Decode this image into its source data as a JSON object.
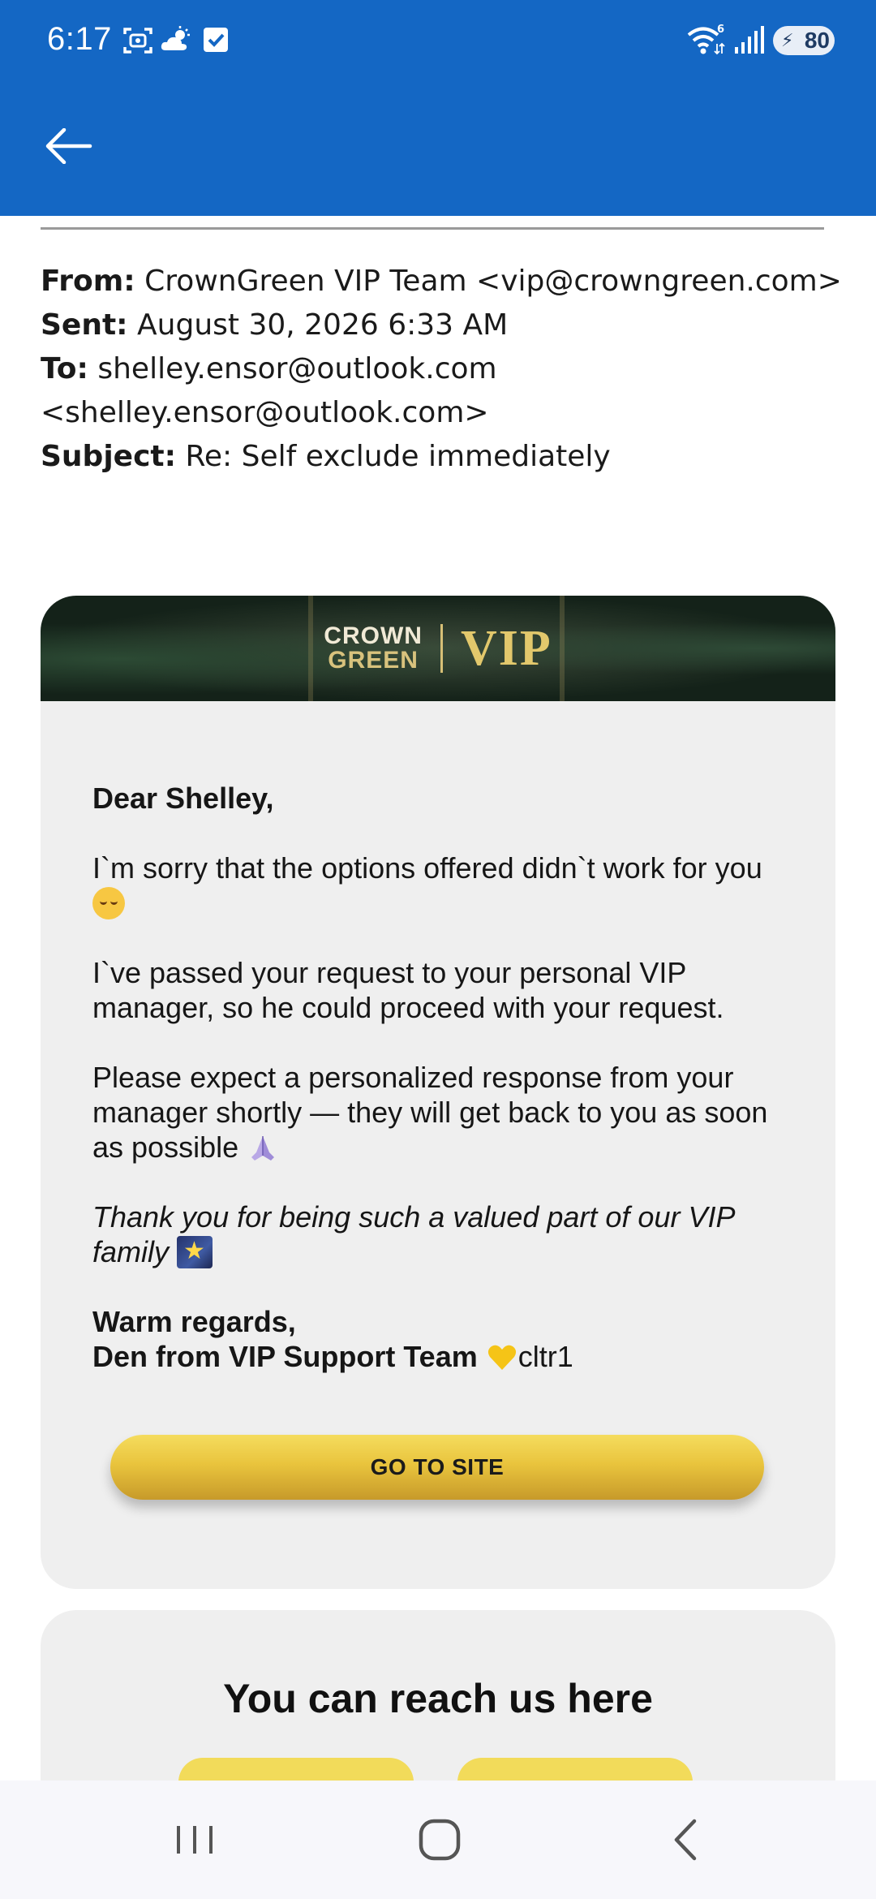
{
  "status_bar": {
    "time": "6:17",
    "battery_level": "80",
    "icons": [
      "screenshot-icon",
      "weather-cloud-icon",
      "checkbox-icon",
      "wifi-6-icon",
      "signal-icon",
      "battery-icon"
    ]
  },
  "app_bar": {
    "back_icon": "arrow-left-icon",
    "color": "#1467c4"
  },
  "email": {
    "from_label": "From:",
    "from_value": "CrownGreen VIP Team <vip@crowngreen.com>",
    "sent_label": "Sent:",
    "sent_value": "August 30, 2026 6:33 AM",
    "to_label": "To:",
    "to_value_line1": "shelley.ensor@outlook.com",
    "to_value_line2": "<shelley.ensor@outlook.com>",
    "subject_label": "Subject:",
    "subject_value": "Re: Self exclude immediately"
  },
  "banner": {
    "logo_line1": "CROWN",
    "logo_line2": "GREEN",
    "logo_vip": "VIP"
  },
  "message": {
    "greeting": "Dear Shelley,",
    "p1": "I`m sorry that the options offered didn`t work for you",
    "p2": "I`ve passed your request to your personal VIP manager, so he could proceed with your request.",
    "p3": "Please expect a personalized response from your manager shortly — they will get back to you as soon as possible",
    "p4": "Thank you for being such a valued part of our VIP family",
    "sign1": "Warm regards,",
    "sign2": "Den from VIP Support Team",
    "sign_tail": "cltr1",
    "cta_label": "GO TO SITE"
  },
  "contact": {
    "title": "You can reach us here"
  },
  "nav": {
    "icons": [
      "recent-apps-icon",
      "home-icon",
      "back-icon"
    ]
  }
}
